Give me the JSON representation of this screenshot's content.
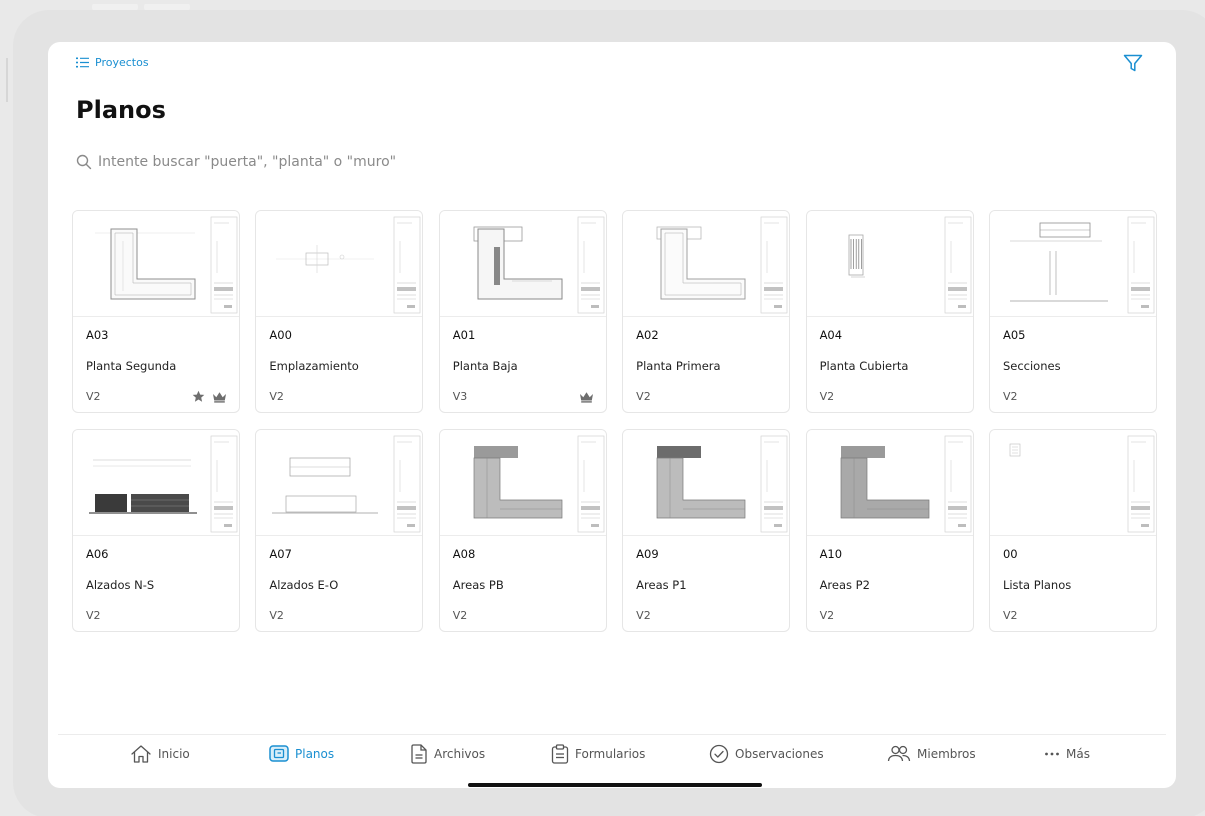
{
  "header": {
    "breadcrumb": "Proyectos",
    "title": "Planos"
  },
  "search": {
    "placeholder": "Intente buscar \"puerta\", \"planta\" o \"muro\""
  },
  "sheets": [
    {
      "code": "A03",
      "name": "Planta Segunda",
      "version": "V2",
      "starred": true,
      "crown": true,
      "thumb": "l-plan"
    },
    {
      "code": "A00",
      "name": "Emplazamiento",
      "version": "V2",
      "starred": false,
      "crown": false,
      "thumb": "site"
    },
    {
      "code": "A01",
      "name": "Planta Baja",
      "version": "V3",
      "starred": false,
      "crown": true,
      "thumb": "ground"
    },
    {
      "code": "A02",
      "name": "Planta Primera",
      "version": "V2",
      "starred": false,
      "crown": false,
      "thumb": "first"
    },
    {
      "code": "A04",
      "name": "Planta Cubierta",
      "version": "V2",
      "starred": false,
      "crown": false,
      "thumb": "roof"
    },
    {
      "code": "A05",
      "name": "Secciones",
      "version": "V2",
      "starred": false,
      "crown": false,
      "thumb": "sections"
    },
    {
      "code": "A06",
      "name": "Alzados N-S",
      "version": "V2",
      "starred": false,
      "crown": false,
      "thumb": "elev-dark"
    },
    {
      "code": "A07",
      "name": "Alzados E-O",
      "version": "V2",
      "starred": false,
      "crown": false,
      "thumb": "elev-light"
    },
    {
      "code": "A08",
      "name": "Areas PB",
      "version": "V2",
      "starred": false,
      "crown": false,
      "thumb": "areas-a"
    },
    {
      "code": "A09",
      "name": "Areas P1",
      "version": "V2",
      "starred": false,
      "crown": false,
      "thumb": "areas-b"
    },
    {
      "code": "A10",
      "name": "Areas P2",
      "version": "V2",
      "starred": false,
      "crown": false,
      "thumb": "areas-c"
    },
    {
      "code": "00",
      "name": "Lista Planos",
      "version": "V2",
      "starred": false,
      "crown": false,
      "thumb": "list"
    }
  ],
  "nav": [
    {
      "label": "Inicio",
      "icon": "home-icon",
      "active": false
    },
    {
      "label": "Planos",
      "icon": "sheets-icon",
      "active": true
    },
    {
      "label": "Archivos",
      "icon": "file-icon",
      "active": false
    },
    {
      "label": "Formularios",
      "icon": "clipboard-icon",
      "active": false
    },
    {
      "label": "Observaciones",
      "icon": "check-circle-icon",
      "active": false
    },
    {
      "label": "Miembros",
      "icon": "members-icon",
      "active": false
    },
    {
      "label": "Más",
      "icon": "more-icon",
      "active": false
    }
  ],
  "colors": {
    "accent": "#1a8fd1",
    "text": "#111111",
    "muted": "#8a8a8a",
    "badge": "#6e6e6e"
  }
}
